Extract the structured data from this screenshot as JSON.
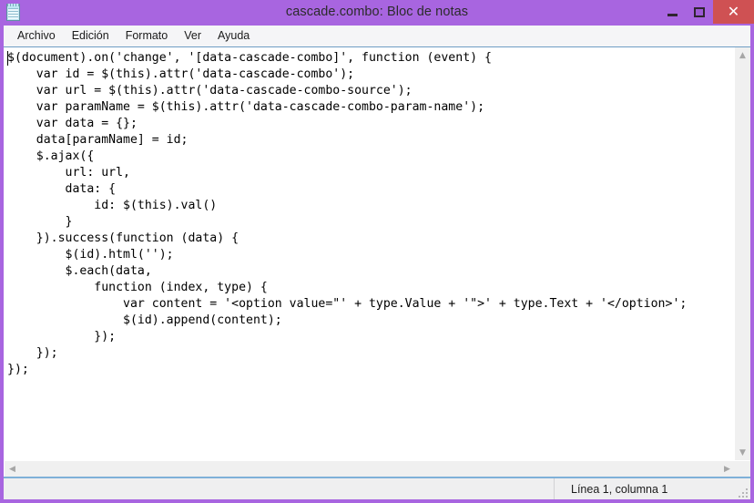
{
  "window": {
    "title": "cascade.combo: Bloc de notas",
    "icon": "notepad-icon",
    "accent_color": "#a865e0",
    "close_button_color": "#cf5153",
    "caption": {
      "minimize_label": "–",
      "maximize_label": "❐",
      "close_label": "✕"
    }
  },
  "menubar": {
    "items": [
      {
        "label": "Archivo"
      },
      {
        "label": "Edición"
      },
      {
        "label": "Formato"
      },
      {
        "label": "Ver"
      },
      {
        "label": "Ayuda"
      }
    ]
  },
  "editor": {
    "content": "$(document).on('change', '[data-cascade-combo]', function (event) {\n    var id = $(this).attr('data-cascade-combo');\n    var url = $(this).attr('data-cascade-combo-source');\n    var paramName = $(this).attr('data-cascade-combo-param-name');\n    var data = {};\n    data[paramName] = id;\n    $.ajax({\n        url: url,\n        data: {\n            id: $(this).val()\n        }\n    }).success(function (data) {\n        $(id).html('');\n        $.each(data,\n            function (index, type) {\n                var content = '<option value=\"' + type.Value + '\">' + type.Text + '</option>';\n                $(id).append(content);\n            });\n    });\n});",
    "text_color": "#000000",
    "background_color": "#ffffff"
  },
  "scrollbars": {
    "vertical": {
      "up_arrow": "▲",
      "down_arrow": "▼"
    },
    "horizontal": {
      "left_arrow": "◀",
      "right_arrow": "▶"
    }
  },
  "statusbar": {
    "position_text": "Línea 1, columna 1"
  }
}
